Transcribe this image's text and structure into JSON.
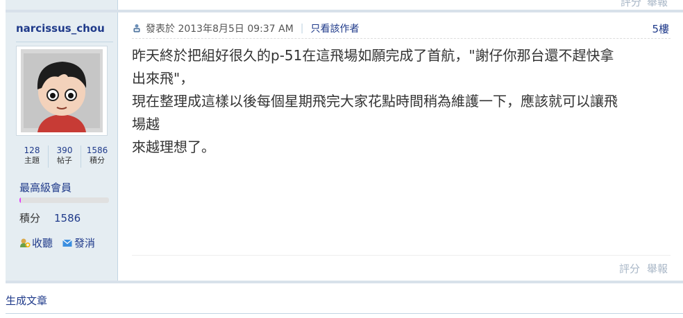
{
  "top": {
    "rate": "評分",
    "report": "舉報"
  },
  "author": {
    "name": "narcissus_chou",
    "stats": [
      {
        "value": "128",
        "label": "主題"
      },
      {
        "value": "390",
        "label": "帖子"
      },
      {
        "value": "1586",
        "label": "積分"
      }
    ],
    "level": "最高級會員",
    "level_progress": 0.01,
    "credit_label": "積分",
    "credit_value": "1586",
    "listen": "收聽",
    "message": "發消"
  },
  "post": {
    "posted_at": "發表於 2013年8月5日 09:37 AM",
    "sep": "|",
    "only_author": "只看該作者",
    "floor": "5樓",
    "lines": [
      "昨天終於把組好很久的p-51在這飛場如願完成了首航，\"謝仔你那台還不趕快拿",
      "出來飛\"，",
      "現在整理成這樣以後每個星期飛完大家花點時間稍為維護一下，應該就可以讓飛",
      "場越",
      "來越理想了。"
    ],
    "rate": "評分",
    "report": "舉報"
  },
  "footer": {
    "generate": "生成文章"
  },
  "colors": {
    "link": "#1f3a8a",
    "sidebar_bg": "#e5edf2",
    "muted": "#a9b7c7",
    "level_bar": "#e040fb"
  }
}
